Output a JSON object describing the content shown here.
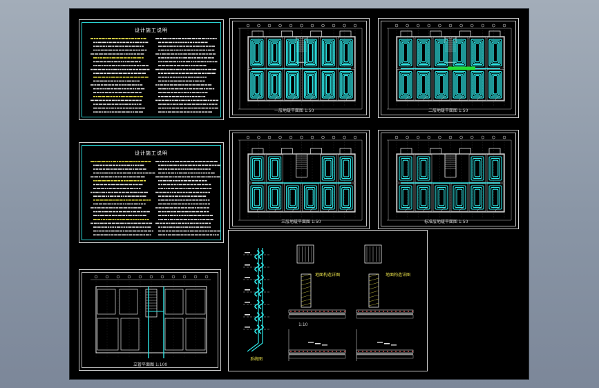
{
  "colors": {
    "background": "#8c97a7",
    "sheet": "#000000",
    "frame": "#cfcfcf",
    "pipe_cyan": "#2ee6e6",
    "text_yellow": "#e8e04a",
    "highlight_green": "#22dd33"
  },
  "sheets": {
    "notes1": {
      "title": "设计施工说明"
    },
    "notes2": {
      "title": "设计施工说明"
    },
    "plan1": {
      "caption": "一层地暖平面图 1:50"
    },
    "plan2": {
      "caption": "二层地暖平面图 1:50"
    },
    "plan3": {
      "caption": "三层地暖平面图 1:50"
    },
    "plan4": {
      "caption": "标准层地暖平面图 1:50"
    },
    "plan5": {
      "caption": "立管平面图 1:100"
    },
    "detail": {
      "riser_caption": "系统图",
      "detail_a": "地面构造详图",
      "detail_b": "地面构造详图",
      "scale": "1:10"
    }
  }
}
